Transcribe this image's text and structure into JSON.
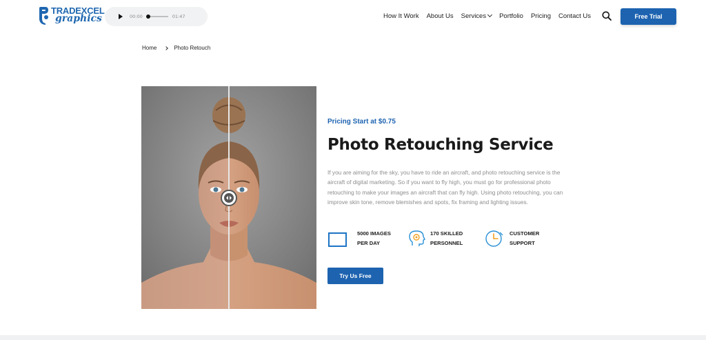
{
  "brand": {
    "logo_top": "TRADEXCEL",
    "logo_bottom": "graphics",
    "accent_color": "#1d63b0"
  },
  "audio_player": {
    "current_time": "00:00",
    "duration": "01:47",
    "progress": 0
  },
  "nav": {
    "items": [
      {
        "label": "How It Work"
      },
      {
        "label": "About Us"
      },
      {
        "label": "Services",
        "has_dropdown": true
      },
      {
        "label": "Portfolio"
      },
      {
        "label": "Pricing"
      },
      {
        "label": "Contact Us"
      }
    ],
    "search_icon": "search-icon",
    "cta_label": "Free Trial"
  },
  "breadcrumb": {
    "home": "Home",
    "current": "Photo Retouch"
  },
  "hero": {
    "pricing": "Pricing Start at $0.75",
    "title": "Photo Retouching Service",
    "description": "If you are aiming for the sky, you have to ride an aircraft, and photo retouching service is the aircraft of digital marketing. So if you want to fly high, you must go for professional photo retouching to make your images an aircraft that can fly high. Using photo retouching, you can improve skin tone, remove blemishes and spots, fix framing and lighting issues.",
    "features": [
      {
        "icon": "image-frame-icon",
        "label": "5000 IMAGES\nPER DAY"
      },
      {
        "icon": "head-gear-icon",
        "label": "170 SKILLED\nPERSONNEL"
      },
      {
        "icon": "clock-support-icon",
        "label": "CUSTOMER\nSUPPORT"
      }
    ],
    "cta_label": "Try Us Free",
    "comparison_image": "before-after-portrait"
  }
}
